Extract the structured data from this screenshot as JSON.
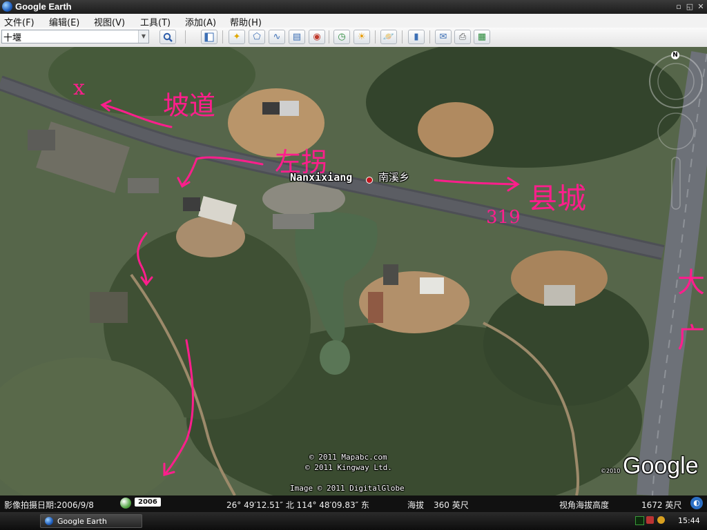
{
  "window": {
    "title": "Google Earth"
  },
  "menu": [
    "文件(F)",
    "编辑(E)",
    "视图(V)",
    "工具(T)",
    "添加(A)",
    "帮助(H)"
  ],
  "search": {
    "value": "十堰"
  },
  "toolbar_icons": [
    "sidebar-toggle-icon",
    "add-placemark-icon",
    "add-polygon-icon",
    "add-path-icon",
    "add-image-overlay-icon",
    "record-tour-icon",
    "historical-imagery-icon",
    "sunlight-icon",
    "switch-to-sky-icon",
    "ruler-icon",
    "email-icon",
    "print-icon",
    "view-in-maps-icon"
  ],
  "map": {
    "place_name_en": "Nanxixiang",
    "place_name_zh": "南溪乡",
    "copyright": [
      "© 2011 Mapabc.com",
      "© 2011 Kingway Ltd.",
      "Image © 2011 DigitalGlobe"
    ],
    "google_logo": "Google",
    "logo_year": "©2010",
    "navigation_north": "N",
    "annotations": [
      "x",
      "坡道",
      "左拐",
      "县城",
      "319",
      "大广"
    ]
  },
  "status": {
    "imagery_date_label": "影像拍摄日期:2006/9/8",
    "year_badge": "2006",
    "coordinates": "26° 49′12.51″ 北 114° 48′09.83″ 东",
    "elevation_label": "海拔",
    "elevation_value": "360 英尺",
    "eye_alt_label": "视角海拔高度",
    "eye_alt_value": "1672 英尺"
  },
  "taskbar": {
    "task_label": "Google Earth",
    "clock": "15:44"
  },
  "colors": {
    "annotation": "#ff1e8c",
    "road": "#4d4f55",
    "highway": "#6d7178"
  }
}
